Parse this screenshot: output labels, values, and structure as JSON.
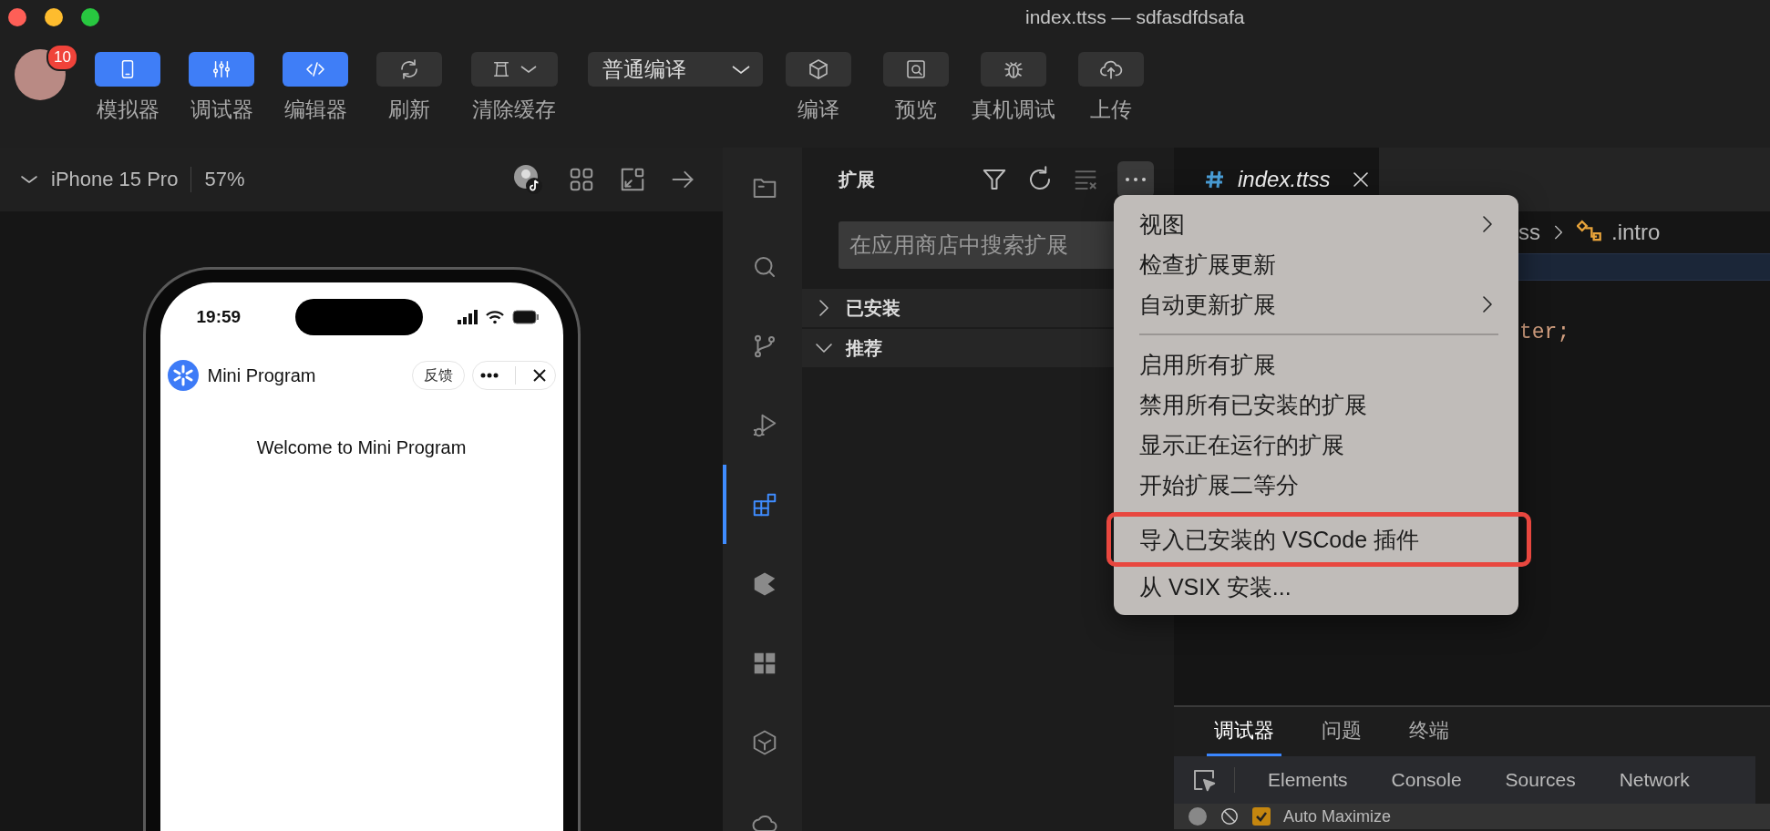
{
  "window": {
    "title": "index.ttss — sdfasdfdsafa"
  },
  "toolbar": {
    "avatar": {
      "badge": "10"
    },
    "items": [
      {
        "kind": "button",
        "label": "模拟器",
        "on": true
      },
      {
        "kind": "button",
        "label": "调试器",
        "on": true
      },
      {
        "kind": "button",
        "label": "编辑器",
        "on": true
      },
      {
        "kind": "button",
        "label": "刷新",
        "on": false
      },
      {
        "kind": "dropdown",
        "label": "清除缓存",
        "on": false
      },
      {
        "kind": "select",
        "value": "普通编译"
      },
      {
        "kind": "button",
        "label": "编译",
        "on": false
      },
      {
        "kind": "button",
        "label": "预览",
        "on": false
      },
      {
        "kind": "button",
        "label": "真机调试",
        "on": false
      },
      {
        "kind": "button",
        "label": "上传",
        "on": false
      }
    ]
  },
  "simulator": {
    "device": "iPhone 15 Pro",
    "zoom": "57%",
    "phone": {
      "time": "19:59",
      "app_name": "Mini Program",
      "feedback": "反馈",
      "content": "Welcome to Mini Program"
    }
  },
  "activity_bar": {
    "items": [
      {
        "selected": false
      },
      {
        "selected": false
      },
      {
        "selected": false
      },
      {
        "selected": false
      },
      {
        "selected": true
      },
      {
        "selected": false
      },
      {
        "selected": false
      },
      {
        "selected": false
      },
      {
        "selected": false
      }
    ]
  },
  "extensions": {
    "title": "扩展",
    "more_button": {
      "pressed": true
    },
    "search": {
      "placeholder": "在应用商店中搜索扩展"
    },
    "sections": [
      {
        "label": "已安装",
        "expanded": false
      },
      {
        "label": "推荐",
        "expanded": true
      }
    ]
  },
  "menu": {
    "items": [
      {
        "kind": "item",
        "label": "视图",
        "submenu": true,
        "annotated": false
      },
      {
        "kind": "item",
        "label": "检查扩展更新",
        "submenu": false,
        "annotated": false
      },
      {
        "kind": "item",
        "label": "自动更新扩展",
        "submenu": true,
        "annotated": false
      },
      {
        "kind": "separator"
      },
      {
        "kind": "item",
        "label": "启用所有扩展",
        "submenu": false,
        "annotated": false
      },
      {
        "kind": "item",
        "label": "禁用所有已安装的扩展",
        "submenu": false,
        "annotated": false
      },
      {
        "kind": "item",
        "label": "显示正在运行的扩展",
        "submenu": false,
        "annotated": false
      },
      {
        "kind": "item",
        "label": "开始扩展二等分",
        "submenu": false,
        "annotated": false
      },
      {
        "kind": "separator"
      },
      {
        "kind": "item",
        "label": "导入已安装的 VSCode 插件",
        "submenu": false,
        "annotated": true
      },
      {
        "kind": "item",
        "label": "从 VSIX 安装...",
        "submenu": false,
        "annotated": false
      }
    ]
  },
  "editor": {
    "tab": {
      "label": "index.ttss"
    },
    "breadcrumb": [
      "ss",
      ".intro"
    ],
    "code_fragment": "ter;"
  },
  "bottom_panel": {
    "tabs": [
      {
        "label": "调试器",
        "selected": true
      },
      {
        "label": "问题",
        "selected": false
      },
      {
        "label": "终端",
        "selected": false
      }
    ],
    "devtools_tabs": [
      "Elements",
      "Console",
      "Sources",
      "Network"
    ],
    "options": [
      {
        "label": "Auto Maximize",
        "checked": true
      }
    ]
  }
}
